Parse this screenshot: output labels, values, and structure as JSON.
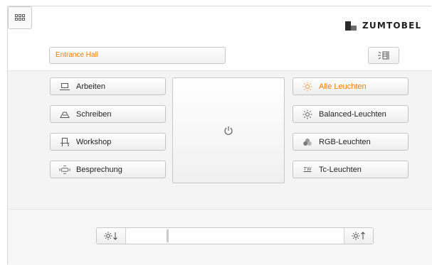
{
  "header": {
    "brand": "ZUMTOBEL"
  },
  "room": {
    "name": "Entrance Hall"
  },
  "scenes_left": [
    {
      "label": "Arbeiten",
      "icon": "desk-icon"
    },
    {
      "label": "Schreiben",
      "icon": "writing-icon"
    },
    {
      "label": "Workshop",
      "icon": "chair-icon"
    },
    {
      "label": "Besprechung",
      "icon": "meeting-table-icon"
    }
  ],
  "scenes_right": [
    {
      "label": "Alle Leuchten",
      "icon": "sun-icon",
      "active": true
    },
    {
      "label": "Balanced-Leuchten",
      "icon": "balanced-light-icon",
      "active": false
    },
    {
      "label": "RGB-Leuchten",
      "icon": "rgb-icon",
      "active": false
    },
    {
      "label": "Tc-Leuchten",
      "icon": "tw-icon",
      "active": false,
      "icon_text": "TW"
    }
  ],
  "dimmer": {
    "level": 0.22,
    "down_icon": "dim-down-icon",
    "up_icon": "dim-up-icon"
  },
  "colors": {
    "accent": "#f07c00",
    "band": "#f4f4f4",
    "border": "#c4c4c4"
  }
}
